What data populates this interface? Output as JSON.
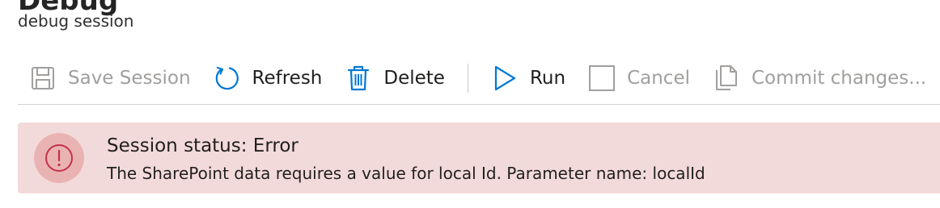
{
  "header": {
    "title": "Debug",
    "subtitle": "debug session"
  },
  "toolbar": {
    "save_label": "Save Session",
    "refresh_label": "Refresh",
    "delete_label": "Delete",
    "run_label": "Run",
    "cancel_label": "Cancel",
    "commit_label": "Commit changes..."
  },
  "status": {
    "title": "Session status: Error",
    "message": "The SharePoint data requires a value for local Id. Parameter name: localId"
  },
  "colors": {
    "accent": "#0078d4",
    "error_background": "#f3dada",
    "error_icon": "#c4314b",
    "disabled_text": "#a19f9d"
  }
}
